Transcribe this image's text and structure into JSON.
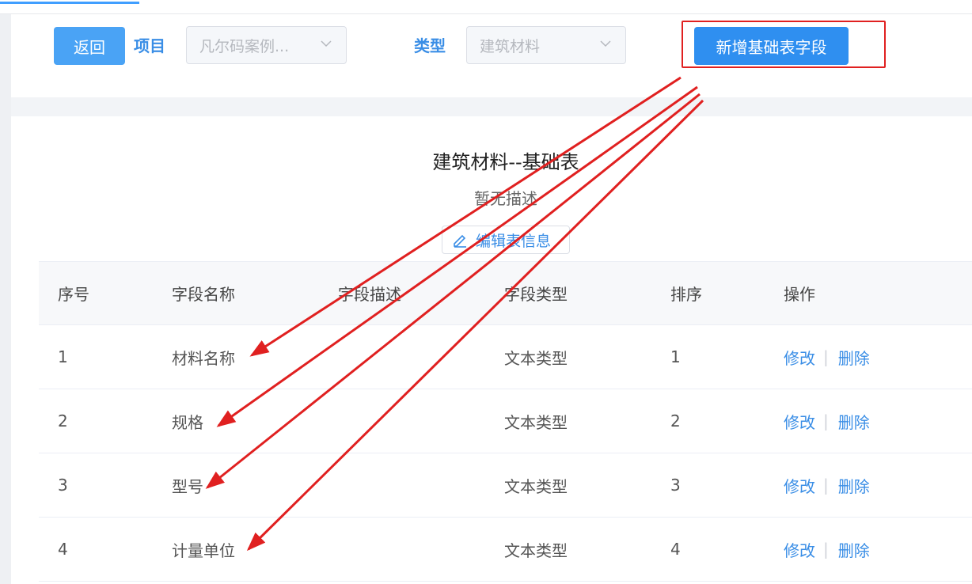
{
  "toolbar": {
    "back_label": "返回",
    "project_label": "项目",
    "project_value": "凡尔码案例...",
    "type_label": "类型",
    "type_value": "建筑材料",
    "add_label": "新增基础表字段"
  },
  "table": {
    "title": "建筑材料--基础表",
    "description": "暂无描述",
    "edit_label": "编辑表信息",
    "columns": [
      "序号",
      "字段名称",
      "字段描述",
      "字段类型",
      "排序",
      "操作"
    ],
    "rows": [
      {
        "idx": "1",
        "name": "材料名称",
        "desc": "",
        "type": "文本类型",
        "sort": "1",
        "edit": "修改",
        "delete": "删除"
      },
      {
        "idx": "2",
        "name": "规格",
        "desc": "",
        "type": "文本类型",
        "sort": "2",
        "edit": "修改",
        "delete": "删除"
      },
      {
        "idx": "3",
        "name": "型号",
        "desc": "",
        "type": "文本类型",
        "sort": "3",
        "edit": "修改",
        "delete": "删除"
      },
      {
        "idx": "4",
        "name": "计量单位",
        "desc": "",
        "type": "文本类型",
        "sort": "4",
        "edit": "修改",
        "delete": "删除"
      }
    ]
  },
  "colors": {
    "primary": "#2f8ff0",
    "link": "#3a8ee6",
    "annotation": "#e02020"
  }
}
